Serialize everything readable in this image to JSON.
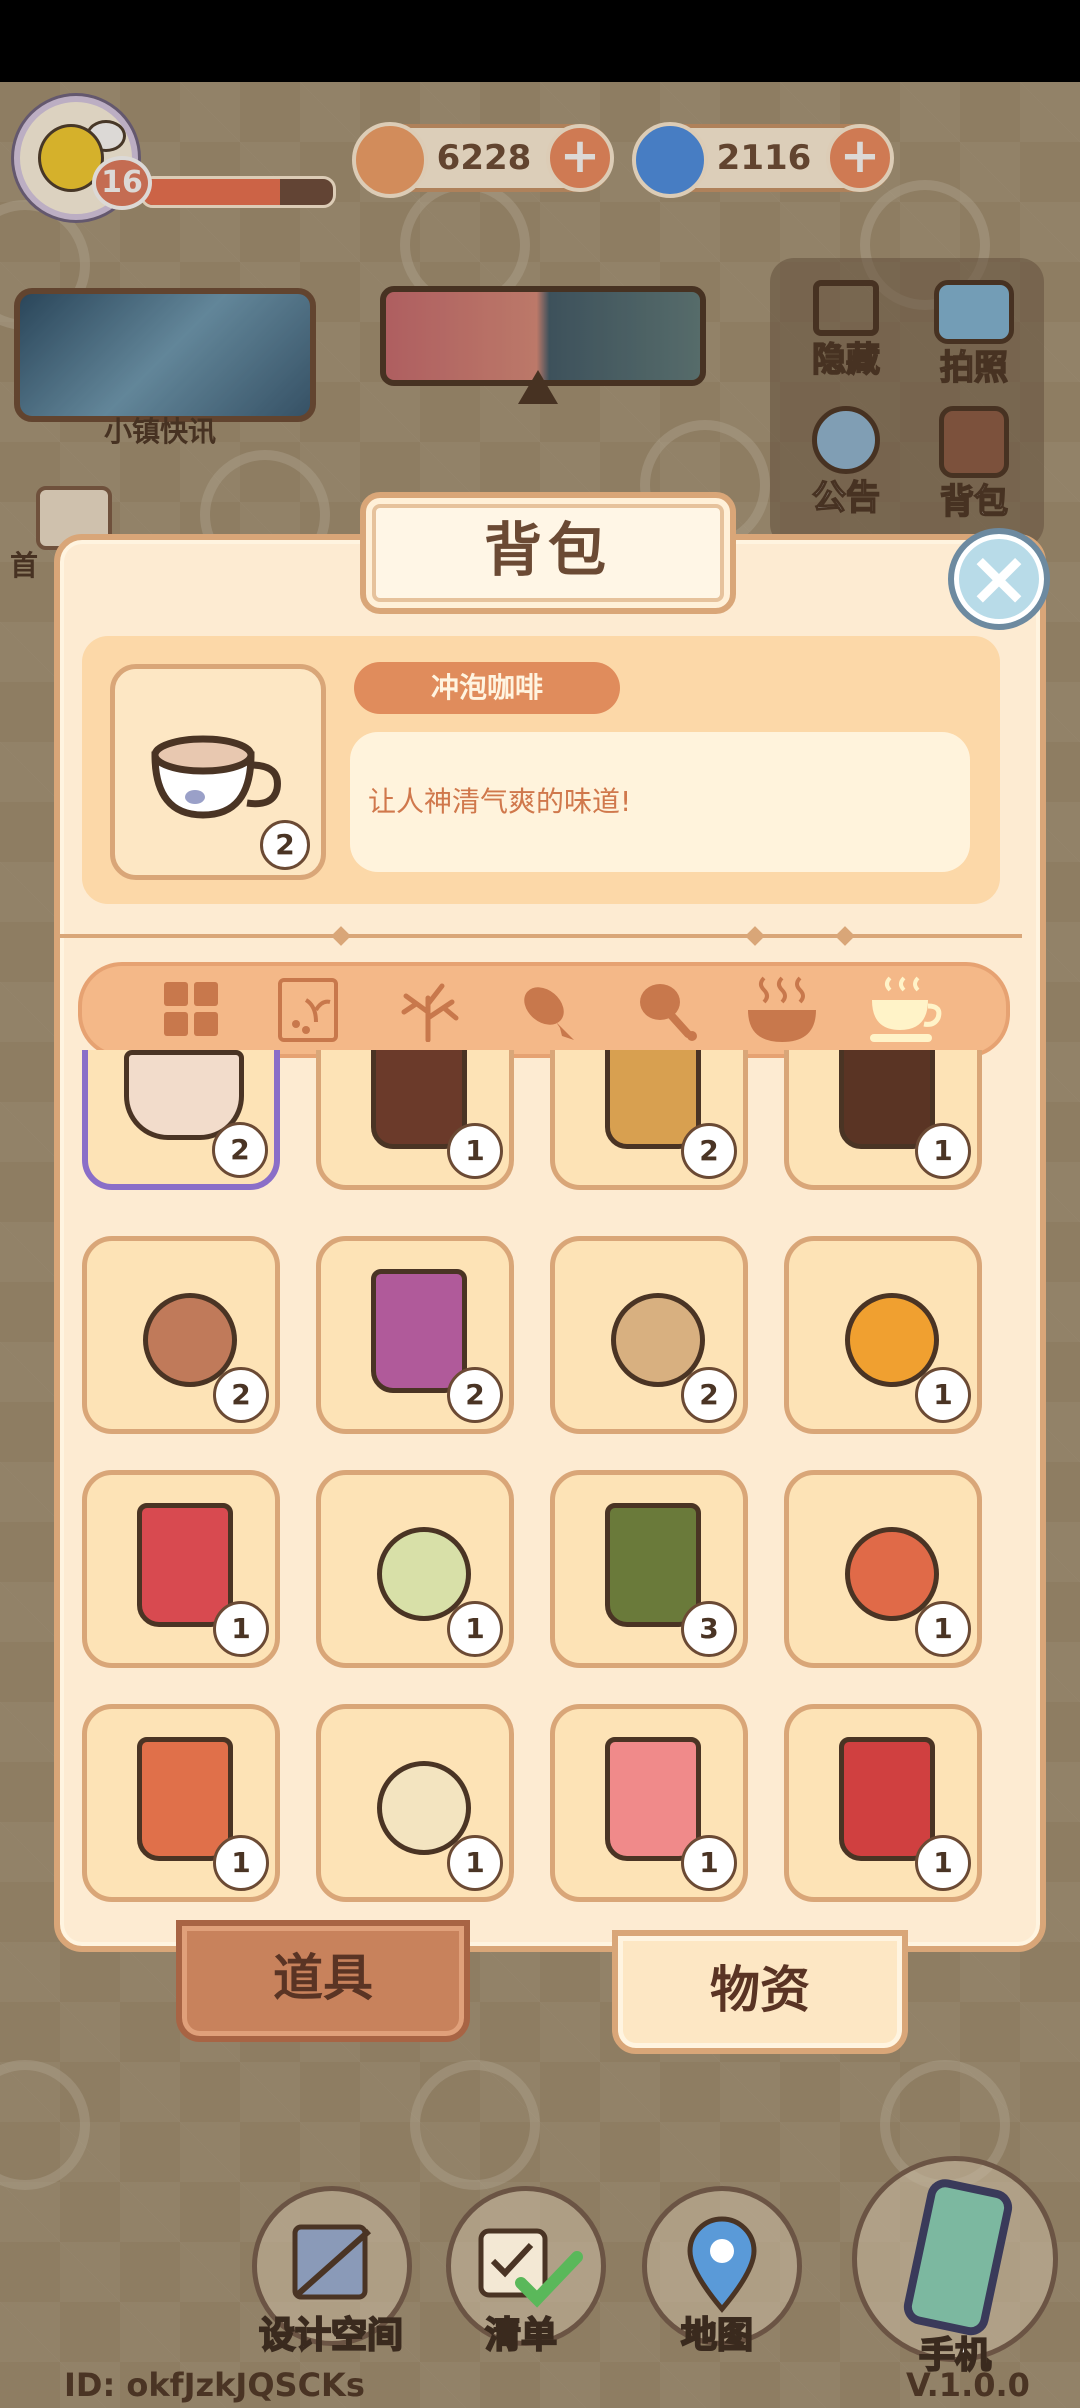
{
  "player": {
    "level": "16",
    "hp_fraction": 0.72
  },
  "currency": [
    {
      "name": "gold-coin",
      "value": "6228",
      "color": "#f3a16a"
    },
    {
      "name": "blue-swirl",
      "value": "2116",
      "color": "#4a8fe8"
    }
  ],
  "left_menu": {
    "news_label": "小镇快讯",
    "side_label": "首"
  },
  "right_menu": [
    {
      "icon": "frame-icon",
      "label": "隐藏"
    },
    {
      "icon": "camera-icon",
      "label": "拍照"
    },
    {
      "icon": "megaphone-icon",
      "label": "公告"
    },
    {
      "icon": "backpack-icon",
      "label": "背包"
    }
  ],
  "panel": {
    "title": "背包",
    "selected": {
      "name": "冲泡咖啡",
      "description": "让人神清气爽的味道!",
      "count": "2"
    }
  },
  "categories": [
    "grid-icon",
    "seedling-icon",
    "plant-icon",
    "fish-icon",
    "drumstick-icon",
    "hot-bowl-icon",
    "coffee-cup-icon"
  ],
  "items": [
    {
      "type": "cup",
      "fill": "#f2dccb",
      "count": "2",
      "selected": true
    },
    {
      "type": "glass",
      "fill": "#6b3a2a",
      "count": "1"
    },
    {
      "type": "glass",
      "fill": "#d8a050",
      "count": "2"
    },
    {
      "type": "glass",
      "fill": "#5a3424",
      "count": "1"
    },
    {
      "type": "bowl",
      "fill": "#c07a5a",
      "count": "2"
    },
    {
      "type": "glass",
      "fill": "#b05a9a",
      "count": "2"
    },
    {
      "type": "bowl",
      "fill": "#d8b080",
      "count": "2"
    },
    {
      "type": "bowl",
      "fill": "#f0a030",
      "count": "1"
    },
    {
      "type": "glass",
      "fill": "#d84a50",
      "count": "1"
    },
    {
      "type": "bowl",
      "fill": "#d8e0a8",
      "count": "1"
    },
    {
      "type": "glass",
      "fill": "#6a7a3a",
      "count": "3"
    },
    {
      "type": "bowl",
      "fill": "#e06a48",
      "count": "1"
    },
    {
      "type": "glass",
      "fill": "#e0704a",
      "count": "1"
    },
    {
      "type": "bowl",
      "fill": "#f3e4c0",
      "count": "1"
    },
    {
      "type": "glass",
      "fill": "#f08a8a",
      "count": "1"
    },
    {
      "type": "glass",
      "fill": "#d04040",
      "count": "1"
    }
  ],
  "tabs": {
    "tools": "道具",
    "materials": "物资"
  },
  "bottom_nav": [
    {
      "icon": "design-icon",
      "label": "设计空间"
    },
    {
      "icon": "checklist-icon",
      "label": "清单"
    },
    {
      "icon": "map-pin-icon",
      "label": "地图"
    },
    {
      "icon": "phone-icon",
      "label": "手机"
    }
  ],
  "footer": {
    "id": "ID: okfJzkJQSCKs",
    "version": "V.1.0.0"
  }
}
